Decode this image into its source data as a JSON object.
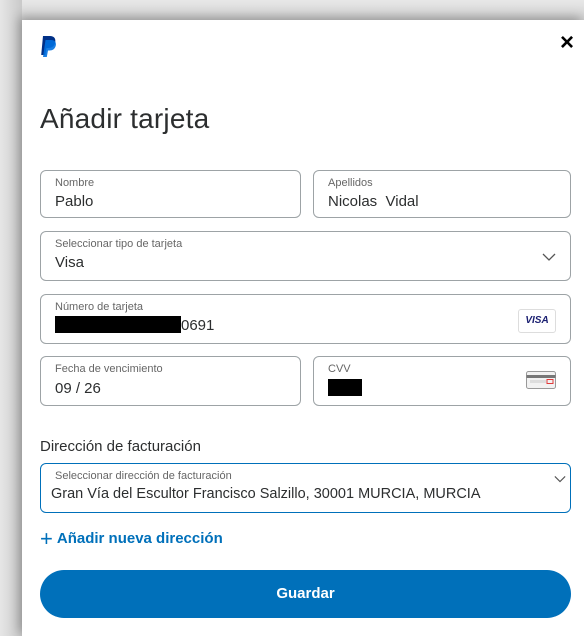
{
  "header": {
    "logo_icon": "paypal-logo-icon",
    "close_label": "×"
  },
  "title": "Añadir tarjeta",
  "form": {
    "first_name": {
      "label": "Nombre",
      "value": "Pablo"
    },
    "last_name": {
      "label": "Apellidos",
      "value": "Nicolas  Vidal"
    },
    "card_type": {
      "label": "Seleccionar tipo de tarjeta",
      "value": "Visa"
    },
    "card_number": {
      "label": "Número de tarjeta",
      "value_suffix": "0691",
      "badge": "VISA"
    },
    "expiry": {
      "label": "Fecha de vencimiento",
      "value": "09 / 26"
    },
    "cvv": {
      "label": "CVV"
    }
  },
  "billing": {
    "section_label": "Dirección de facturación",
    "select_label": "Seleccionar dirección de facturación",
    "value": "Gran Vía del Escultor Francisco Salzillo, 30001 MURCIA, MURCIA",
    "add_link": "Añadir nueva dirección"
  },
  "save_label": "Guardar",
  "colors": {
    "accent": "#0070ba",
    "border": "#9da3a6",
    "text": "#2c2e2f"
  }
}
